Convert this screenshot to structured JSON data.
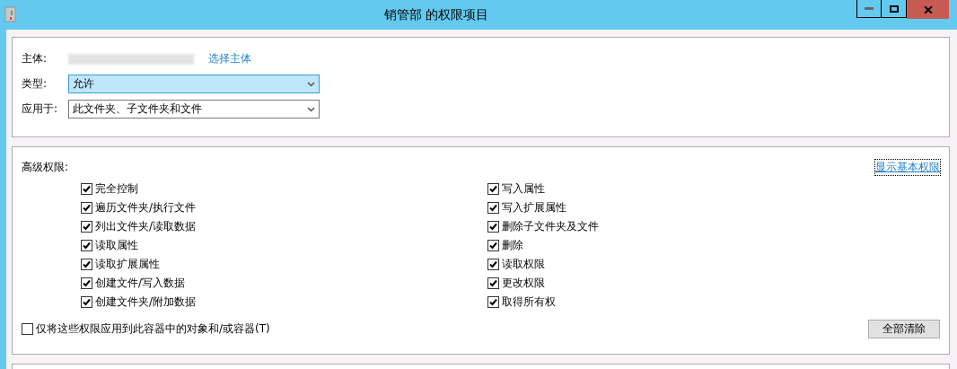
{
  "window": {
    "title": "销管部 的权限项目"
  },
  "principal": {
    "label": "主体:",
    "link": "选择主体"
  },
  "type_field": {
    "label": "类型:",
    "value": "允许",
    "focused": true
  },
  "applies_to": {
    "label": "应用于:",
    "value": "此文件夹、子文件夹和文件",
    "focused": false
  },
  "advanced": {
    "title": "高级权限:",
    "toggle_link": "显示基本权限",
    "permissions": [
      {
        "label": "完全控制",
        "checked": true
      },
      {
        "label": "遍历文件夹/执行文件",
        "checked": true
      },
      {
        "label": "列出文件夹/读取数据",
        "checked": true
      },
      {
        "label": "读取属性",
        "checked": true
      },
      {
        "label": "读取扩展属性",
        "checked": true
      },
      {
        "label": "创建文件/写入数据",
        "checked": true
      },
      {
        "label": "创建文件夹/附加数据",
        "checked": true
      },
      {
        "label": "写入属性",
        "checked": true
      },
      {
        "label": "写入扩展属性",
        "checked": true
      },
      {
        "label": "删除子文件夹及文件",
        "checked": true
      },
      {
        "label": "删除",
        "checked": true
      },
      {
        "label": "读取权限",
        "checked": true
      },
      {
        "label": "更改权限",
        "checked": true
      },
      {
        "label": "取得所有权",
        "checked": true
      }
    ],
    "apply_only": {
      "label": "仅将这些权限应用到此容器中的对象和/或容器(T)",
      "checked": false
    },
    "clear_button": "全部清除"
  }
}
